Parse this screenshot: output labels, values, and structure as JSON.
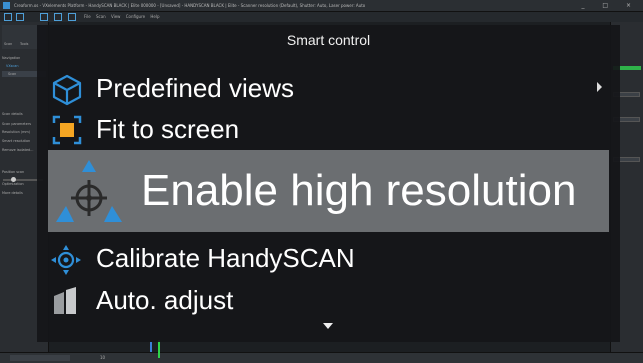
{
  "window": {
    "title": "Creaform.os - VXelements Platform - HandySCAN BLACK | Elite 000000 - [Unsaved] - HANDYSCAN BLACK | Elite - Scanner resolution (Default), Shutter: Auto, Laser power: Auto",
    "controls": "_ □ ×"
  },
  "toolbar": {
    "menu": "File  Scan  View  Configure  Help"
  },
  "left_panel": {
    "header_items": [
      "Scan",
      "Tools"
    ],
    "navigation_label": "Navigation",
    "tree_root": "VXscan",
    "tree_item": "Scan",
    "scan_details": "Scan details",
    "scan_parameters": "Scan parameters",
    "params": [
      "Resolution (mm)",
      "Smart resolution",
      "Remove isolated..."
    ],
    "positioning": "Position scan",
    "optimization": "Optimization",
    "more": "More details"
  },
  "right_panel": {
    "fields": [
      "",
      "",
      ""
    ]
  },
  "status_bar": {
    "value": "10"
  },
  "smart_control": {
    "title": "Smart control",
    "items": [
      {
        "label": "Predefined views",
        "icon": "cube-icon",
        "has_submenu": true
      },
      {
        "label": "Fit to screen",
        "icon": "fit-to-screen-icon"
      },
      {
        "label": "Enable high resolution",
        "icon": "crosshair-triangle-icon",
        "selected": true
      },
      {
        "label": "Calibrate HandySCAN",
        "icon": "calibrate-icon"
      },
      {
        "label": "Auto. adjust",
        "icon": "auto-adjust-icon"
      }
    ],
    "colors": {
      "accent_blue": "#2f8fd8",
      "accent_orange": "#f5a623",
      "selected_bg": "#6b6e71"
    }
  }
}
